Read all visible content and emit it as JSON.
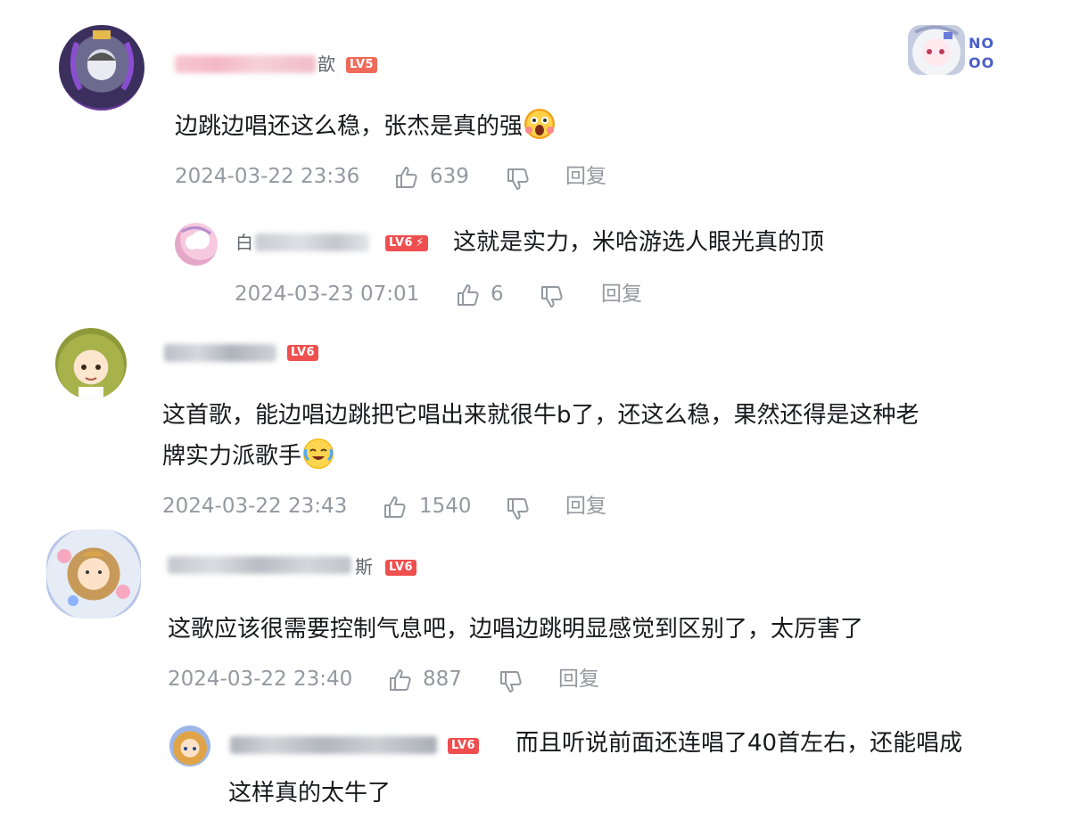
{
  "comments": [
    {
      "user": {
        "name_visible_tail": "歆",
        "level": "LV5",
        "avatar": "dark-purple-character-avatar"
      },
      "content": "边跳边唱还这么稳，张杰是真的强",
      "emoji": "scared-emoji",
      "time": "2024-03-22 23:36",
      "likes": "639",
      "reply_label": "回复",
      "replies": [
        {
          "user": {
            "name_visible_head": "白",
            "level": "LV6",
            "avatar": "pink-white-avatar"
          },
          "content": "这就是实力，米哈游选人眼光真的顶",
          "time": "2024-03-23 07:01",
          "likes": "6",
          "reply_label": "回复"
        }
      ]
    },
    {
      "user": {
        "level": "LV6",
        "avatar": "green-hair-girl-avatar"
      },
      "content_line1": "这首歌，能边唱边跳把它唱出来就很牛b了，还这么稳，果然还得是这种老",
      "content_line2": "牌实力派歌手",
      "emoji": "crying-laugh-emoji",
      "time": "2024-03-22 23:43",
      "likes": "1540",
      "reply_label": "回复"
    },
    {
      "user": {
        "name_visible_tail": "斯",
        "level": "LV6",
        "avatar": "blonde-boy-flower-frame-avatar"
      },
      "content": "这歌应该很需要控制气息吧，边唱边跳明显感觉到区别了，太厉害了",
      "time": "2024-03-22 23:40",
      "likes": "887",
      "reply_label": "回复",
      "replies": [
        {
          "user": {
            "level": "LV6",
            "avatar": "blonde-boy-avatar"
          },
          "content_line1": "而且听说前面还连唱了40首左右，还能唱成",
          "content_line2": "这样真的太牛了"
        }
      ]
    }
  ],
  "corner_badge": {
    "text_line1": "NO",
    "text_line2": "OO",
    "avatar": "white-hair-chibi-avatar"
  },
  "colors": {
    "meta": "#9499a0",
    "level_badge": "#f06a5a",
    "text": "#18191c"
  }
}
